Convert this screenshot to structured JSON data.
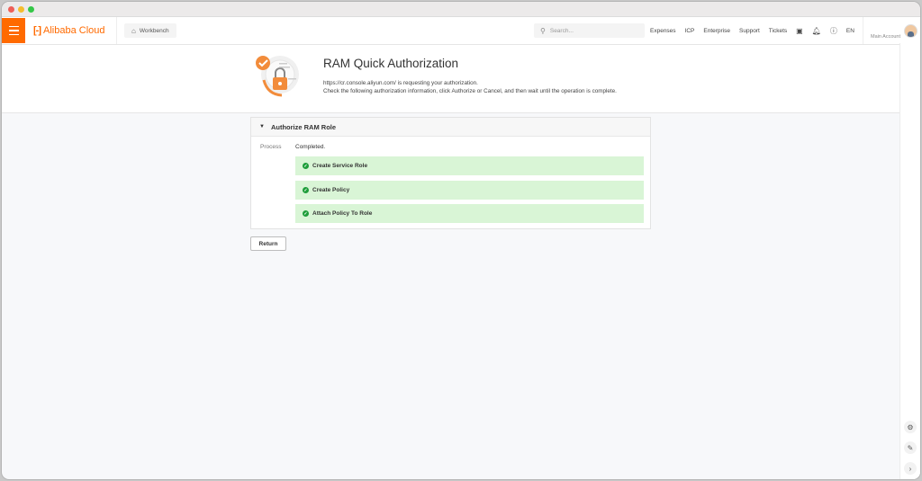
{
  "window": {
    "traffic_lights": [
      "#ee5f57",
      "#f5bd2e",
      "#35c748"
    ]
  },
  "topbar": {
    "menu_icon": "hamburger-icon",
    "logo_mark": "[-]",
    "logo_text": "Alibaba Cloud",
    "workbench_label": "Workbench",
    "search_placeholder": "Search...",
    "links": {
      "expenses": "Expenses",
      "icp": "ICP",
      "enterprise": "Enterprise",
      "support": "Support",
      "tickets": "Tickets"
    },
    "icons": [
      "terminal-icon",
      "bell-icon",
      "help-icon"
    ],
    "lang": "EN",
    "account_label": "Main Account",
    "accent": "#ff6a00"
  },
  "header": {
    "title": "RAM Quick Authorization",
    "line1": "https://cr.console.aliyun.com/ is requesting your authorization.",
    "line2": "Check the following authorization information, click Authorize or Cancel, and then wait until the operation is complete."
  },
  "card": {
    "title": "Authorize RAM Role",
    "process_label": "Process",
    "process_status": "Completed.",
    "steps": [
      {
        "label": "Create Service Role",
        "status": "success"
      },
      {
        "label": "Create Policy",
        "status": "success"
      },
      {
        "label": "Attach Policy To Role",
        "status": "success"
      }
    ],
    "success_bg": "#d9f5d6",
    "success_icon_color": "#1e9e3a"
  },
  "actions": {
    "return_label": "Return"
  },
  "rail": {
    "icons": [
      "settings-icon",
      "edit-icon",
      "chevron-right-icon"
    ]
  }
}
